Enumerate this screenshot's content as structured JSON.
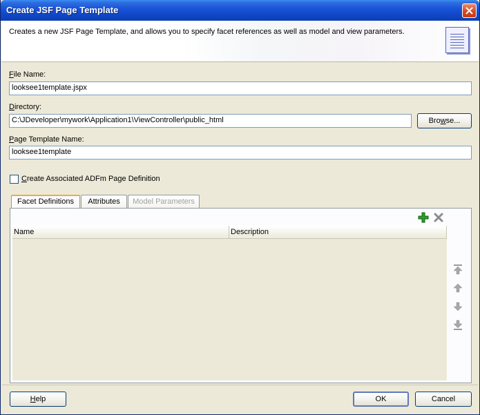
{
  "window": {
    "title": "Create JSF Page Template"
  },
  "header": {
    "description": "Creates a new JSF Page Template, and allows you to specify facet references as well as model and view parameters."
  },
  "form": {
    "file_name_label_mnemonic": "F",
    "file_name_label_rest": "ile Name:",
    "file_name_value": "looksee1template.jspx",
    "directory_label_mnemonic": "D",
    "directory_label_rest": "irectory:",
    "directory_value": "C:\\JDeveloper\\mywork\\Application1\\ViewController\\public_html",
    "browse_label_pre": "Bro",
    "browse_label_mnemonic": "w",
    "browse_label_post": "se...",
    "template_name_label_mnemonic": "P",
    "template_name_label_rest": "age Template Name:",
    "template_name_value": "looksee1template",
    "checkbox_label_mnemonic": "C",
    "checkbox_label_rest": "reate Associated ADFm Page Definition",
    "checkbox_checked": false
  },
  "tabs": [
    {
      "label": "Facet Definitions",
      "state": "active"
    },
    {
      "label": "Attributes",
      "state": "normal"
    },
    {
      "label": "Model Parameters",
      "state": "disabled"
    }
  ],
  "table": {
    "columns": [
      "Name",
      "Description"
    ],
    "rows": []
  },
  "toolbar": {
    "add_icon": "green-plus-icon",
    "remove_icon": "gray-x-icon"
  },
  "side_buttons": [
    "move-to-top-icon",
    "move-up-icon",
    "move-down-icon",
    "move-to-bottom-icon"
  ],
  "footer": {
    "help_label_mnemonic": "H",
    "help_label_rest": "elp",
    "ok_label": "OK",
    "cancel_label": "Cancel"
  },
  "colors": {
    "titlebar": "#1048c8",
    "dialog_bg": "#ece9d8",
    "field_border": "#7f9db9",
    "add_green": "#2a9d2a"
  }
}
